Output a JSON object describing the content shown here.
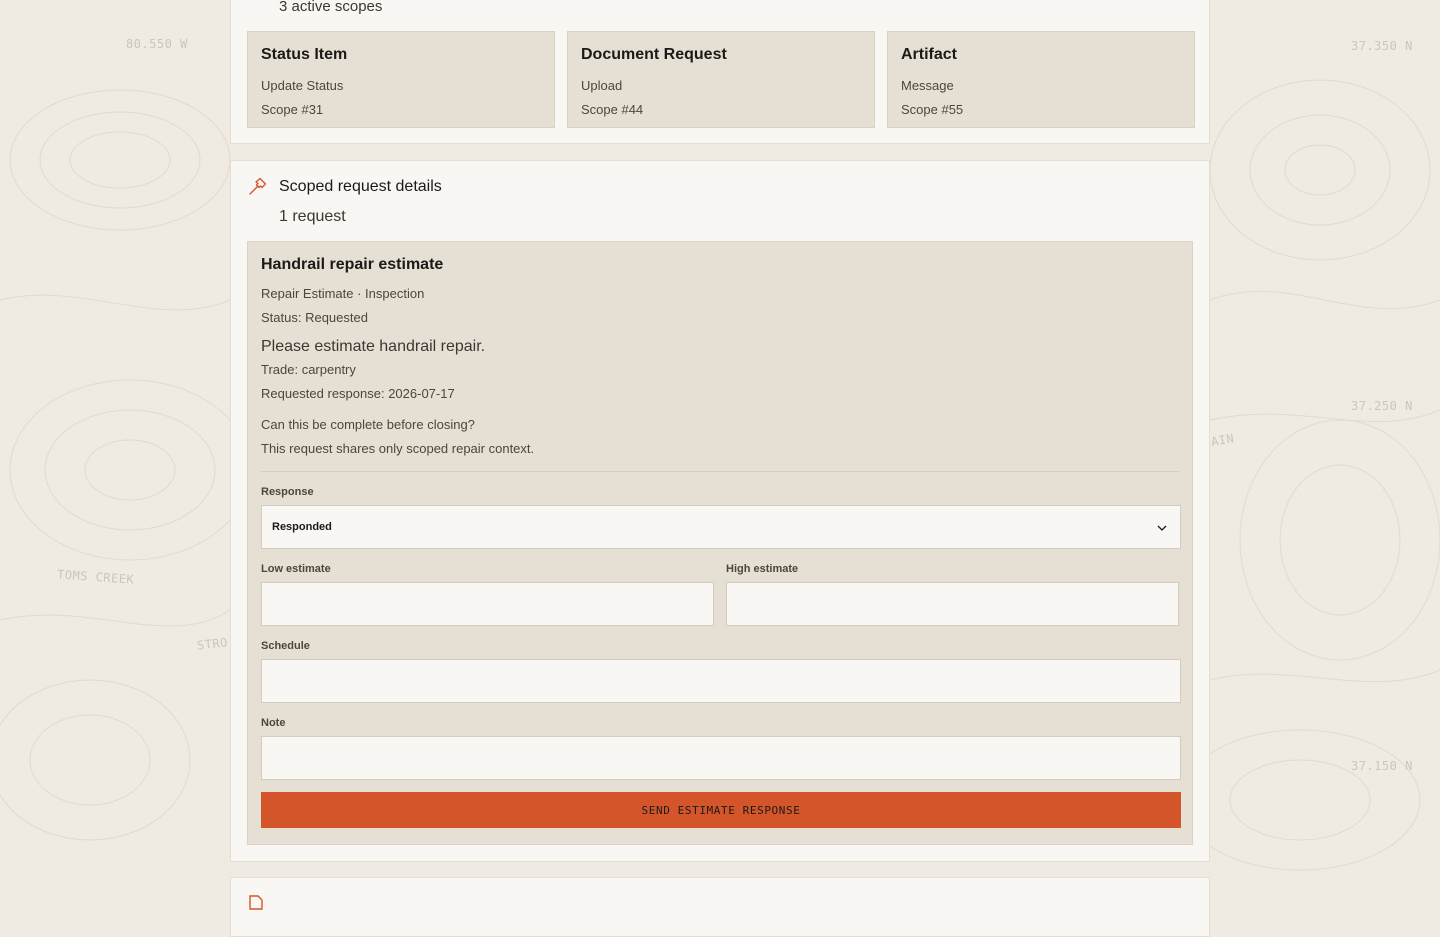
{
  "map_labels": {
    "tl": "80.550 W",
    "tr": "37.350 N",
    "mr": "37.250 N",
    "br": "37.150 N",
    "creek": "TOMS CREEK",
    "strom": "STRO",
    "ain": "AIN"
  },
  "scopes": {
    "summary": "3 active scopes",
    "cards": [
      {
        "title": "Status Item",
        "kind": "Update Status",
        "scope": "Scope #31"
      },
      {
        "title": "Document Request",
        "kind": "Upload",
        "scope": "Scope #44"
      },
      {
        "title": "Artifact",
        "kind": "Message",
        "scope": "Scope #55"
      }
    ]
  },
  "details": {
    "icon": "hammer-icon",
    "title": "Scoped request details",
    "count": "1 request",
    "request": {
      "title": "Handrail repair estimate",
      "meta": "Repair Estimate · Inspection",
      "status": "Status: Requested",
      "description": "Please estimate handrail repair.",
      "trade": "Trade: carpentry",
      "requested_response": "Requested response: 2026-07-17",
      "question": "Can this be complete before closing?",
      "note": "This request shares only scoped repair context."
    },
    "form": {
      "response_label": "Response",
      "response_value": "Responded",
      "low_label": "Low estimate",
      "low_value": "",
      "high_label": "High estimate",
      "high_value": "",
      "schedule_label": "Schedule",
      "schedule_value": "",
      "note_label": "Note",
      "note_value": "",
      "submit_label": "SEND ESTIMATE RESPONSE"
    }
  },
  "colors": {
    "accent": "#d5552a",
    "page_bg": "#efebe3",
    "card_bg": "#e6e0d4",
    "panel_bg": "#f8f7f3"
  }
}
